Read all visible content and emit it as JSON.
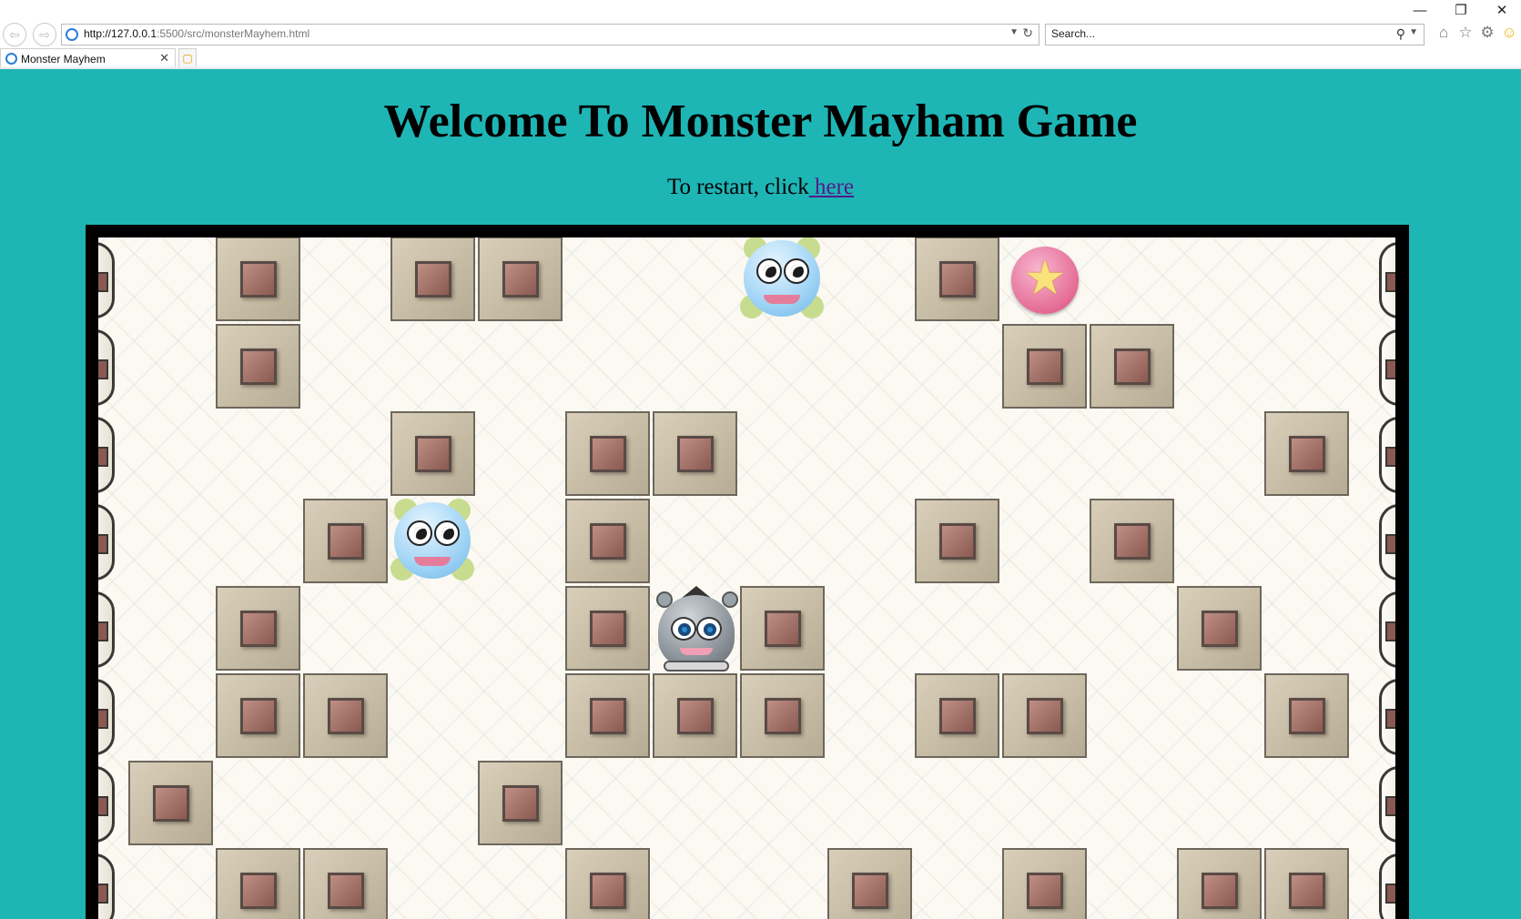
{
  "browser": {
    "url_host": "http://127.0.0.1",
    "url_rest": ":5500/src/monsterMayhem.html",
    "search_placeholder": "Search...",
    "tab_title": "Monster Mayhem",
    "window_controls": {
      "minimize": "—",
      "restore": "❐",
      "close": "✕"
    },
    "nav": {
      "back": "⇦",
      "forward": "⇨"
    },
    "toolbar_icons": [
      "home-icon",
      "favorites-star-icon",
      "settings-gear-icon",
      "smiley-feedback-icon"
    ]
  },
  "page": {
    "title": "Welcome To Monster Mayham Game",
    "restart_prefix": "To restart, click",
    "restart_link": " here",
    "background_color": "#1eb5b5",
    "link_color": "#551a8b"
  },
  "game": {
    "grid_cell_units": "one board cell",
    "blocks": [
      [
        1,
        0
      ],
      [
        3,
        0
      ],
      [
        4,
        0
      ],
      [
        9,
        0
      ],
      [
        1,
        1
      ],
      [
        10,
        1
      ],
      [
        11,
        1
      ],
      [
        3,
        2
      ],
      [
        5,
        2
      ],
      [
        6,
        2
      ],
      [
        13,
        2
      ],
      [
        2,
        3
      ],
      [
        5,
        3
      ],
      [
        9,
        3
      ],
      [
        11,
        3
      ],
      [
        1,
        4
      ],
      [
        5,
        4
      ],
      [
        7,
        4
      ],
      [
        12,
        4
      ],
      [
        1,
        5
      ],
      [
        2,
        5
      ],
      [
        5,
        5
      ],
      [
        6,
        5
      ],
      [
        7,
        5
      ],
      [
        9,
        5
      ],
      [
        10,
        5
      ],
      [
        13,
        5
      ],
      [
        0,
        6
      ],
      [
        4,
        6
      ],
      [
        1,
        7
      ],
      [
        2,
        7
      ],
      [
        5,
        7
      ],
      [
        8,
        7
      ],
      [
        10,
        7
      ],
      [
        12,
        7
      ],
      [
        13,
        7
      ]
    ],
    "monsters": [
      [
        7,
        0
      ],
      [
        3,
        3
      ]
    ],
    "player": [
      6,
      4
    ],
    "goal_star": [
      10,
      0
    ]
  }
}
